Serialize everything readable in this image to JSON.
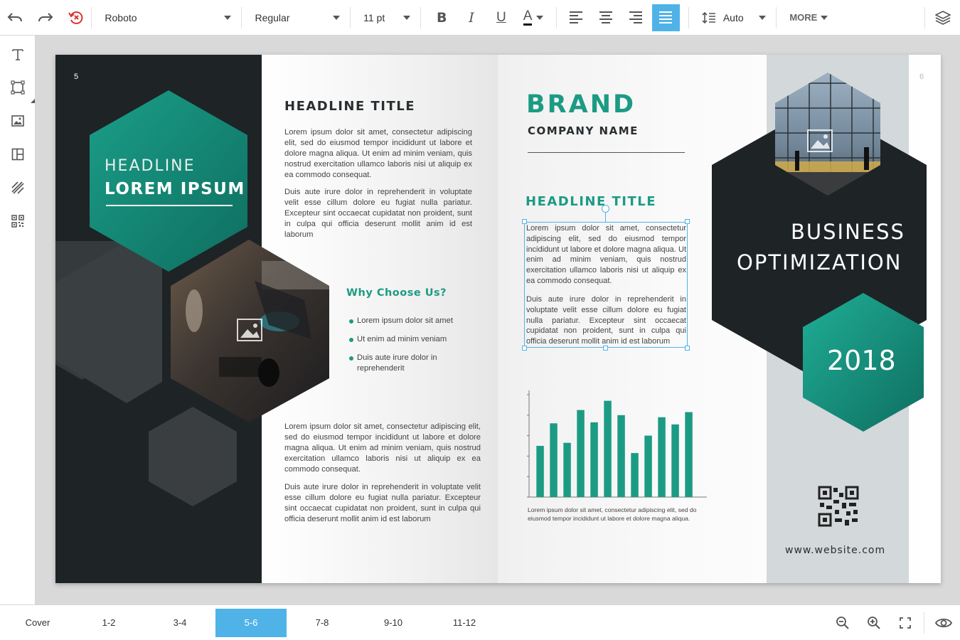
{
  "toolbar": {
    "font_family": "Roboto",
    "font_style": "Regular",
    "font_size": "11 pt",
    "line_spacing": "Auto",
    "more_label": "MORE",
    "bold_label": "B",
    "italic_label": "I",
    "underline_label": "U",
    "color_label": "A"
  },
  "colors": {
    "accent": "#4fb3e8",
    "brand_teal": "#1c9b84",
    "dark": "#1e2326"
  },
  "pages": {
    "left_page_number": "5",
    "right_page_number": "6"
  },
  "cover_panel": {
    "headline_line1": "HEADLINE",
    "headline_line2": "LOREM IPSUM"
  },
  "middle_panel": {
    "title": "HEADLINE TITLE",
    "para1": "Lorem ipsum dolor sit amet, consectetur adipiscing elit, sed do eiusmod tempor incididunt ut labore et dolore magna aliqua. Ut enim ad minim veniam, quis nostrud exercitation ullamco laboris nisi ut aliquip ex ea commodo consequat.",
    "para2": "Duis aute irure dolor in reprehenderit in voluptate velit esse cillum dolore eu fugiat nulla pariatur. Excepteur sint occaecat cupidatat non proident, sunt in culpa qui officia deserunt mollit anim id est laborum",
    "why_title": "Why Choose Us?",
    "bullets": [
      "Lorem ipsum dolor sit amet",
      "Ut enim ad minim veniam",
      "Duis aute irure dolor in reprehenderit"
    ],
    "para3": "Lorem ipsum dolor sit amet, consectetur adipiscing elit, sed do eiusmod tempor incididunt ut labore et dolore magna aliqua. Ut enim ad minim veniam, quis nostrud exercitation ullamco laboris nisi ut aliquip ex ea commodo consequat.",
    "para4": "Duis aute irure dolor in reprehenderit in voluptate velit esse cillum dolore eu fugiat nulla pariatur. Excepteur sint occaecat cupidatat non proident, sunt in culpa qui officia deserunt mollit anim id est laborum"
  },
  "brand_panel": {
    "brand": "BRAND",
    "company": "COMPANY NAME",
    "title": "HEADLINE TITLE",
    "para1": "Lorem ipsum dolor sit amet, consectetur adipiscing elit, sed do eiusmod tempor incididunt ut labore et dolore magna aliqua. Ut enim ad minim veniam, quis nostrud exercitation ullamco laboris nisi ut aliquip ex ea commodo consequat.",
    "para2": "Duis aute irure dolor in reprehenderit in voluptate velit esse cillum dolore eu fugiat nulla pariatur. Excepteur sint occaecat cupidatat non proident, sunt in culpa qui officia deserunt mollit anim id est laborum",
    "chart_caption": "Lorem ipsum dolor sit amet, consectetur adipiscing elit, sed do eiusmod tempor incididunt ut labore et dolore magna aliqua."
  },
  "back_panel": {
    "title_line1": "BUSINESS",
    "title_line2": "OPTIMIZATION",
    "year": "2018",
    "website": "www.website.com"
  },
  "chart_data": {
    "type": "bar",
    "values": [
      50,
      72,
      53,
      85,
      73,
      94,
      80,
      43,
      60,
      78,
      71,
      83
    ],
    "ylim": [
      0,
      100
    ],
    "grid": false
  },
  "page_tabs": [
    "Cover",
    "1-2",
    "3-4",
    "5-6",
    "7-8",
    "9-10",
    "11-12"
  ],
  "active_tab": "5-6"
}
